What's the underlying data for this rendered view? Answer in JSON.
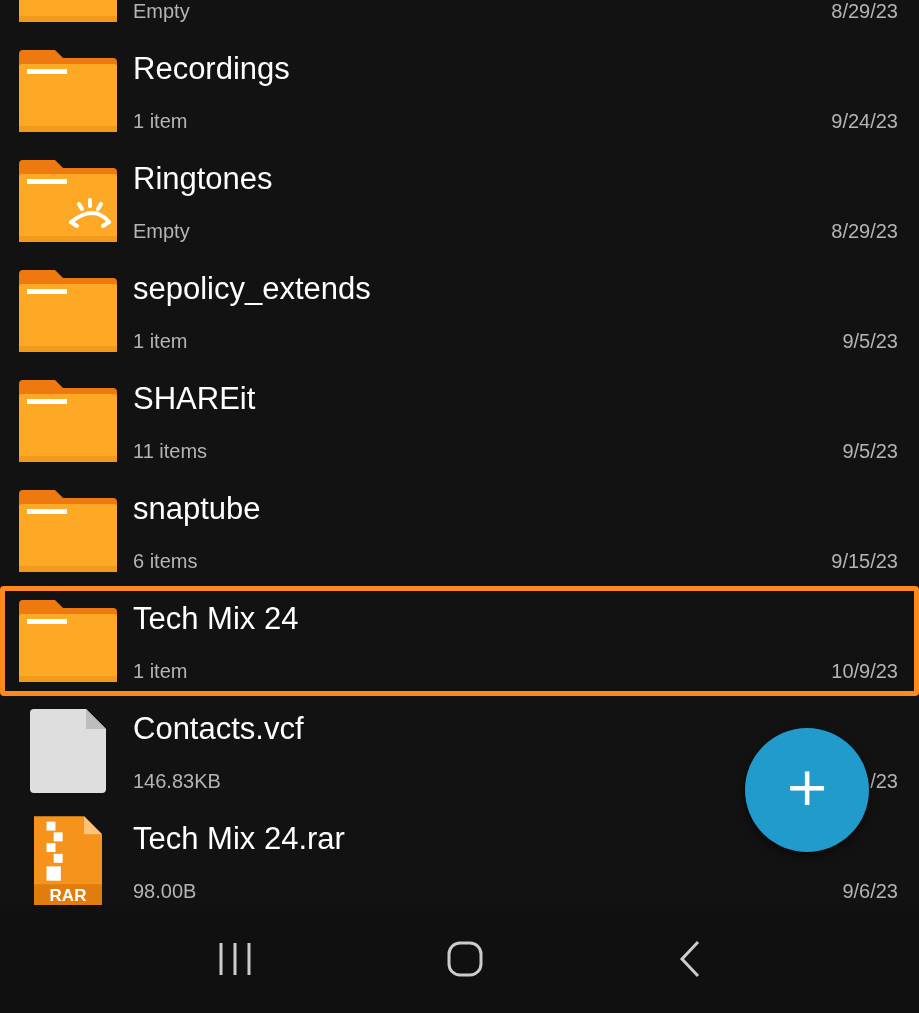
{
  "files": [
    {
      "kind": "folder",
      "subtitle": "Empty",
      "date": "8/29/23",
      "selected": false
    },
    {
      "kind": "folder",
      "name": "Recordings",
      "subtitle": "1 item",
      "date": "9/24/23",
      "selected": false
    },
    {
      "kind": "ringtone-folder",
      "name": "Ringtones",
      "subtitle": "Empty",
      "date": "8/29/23",
      "selected": false
    },
    {
      "kind": "folder",
      "name": "sepolicy_extends",
      "subtitle": "1 item",
      "date": "9/5/23",
      "selected": false
    },
    {
      "kind": "folder",
      "name": "SHAREit",
      "subtitle": "11 items",
      "date": "9/5/23",
      "selected": false
    },
    {
      "kind": "folder",
      "name": "snaptube",
      "subtitle": "6 items",
      "date": "9/15/23",
      "selected": false
    },
    {
      "kind": "folder",
      "name": "Tech Mix 24",
      "subtitle": "1 item",
      "date": "10/9/23",
      "selected": true
    },
    {
      "kind": "file",
      "name": "Contacts.vcf",
      "subtitle": "146.83KB",
      "date": "/23",
      "selected": false
    },
    {
      "kind": "archive",
      "name": "Tech Mix 24.rar",
      "subtitle": "98.00B",
      "date": "9/6/23",
      "selected": false,
      "label": "RAR"
    }
  ],
  "fab": {
    "label": "+"
  }
}
